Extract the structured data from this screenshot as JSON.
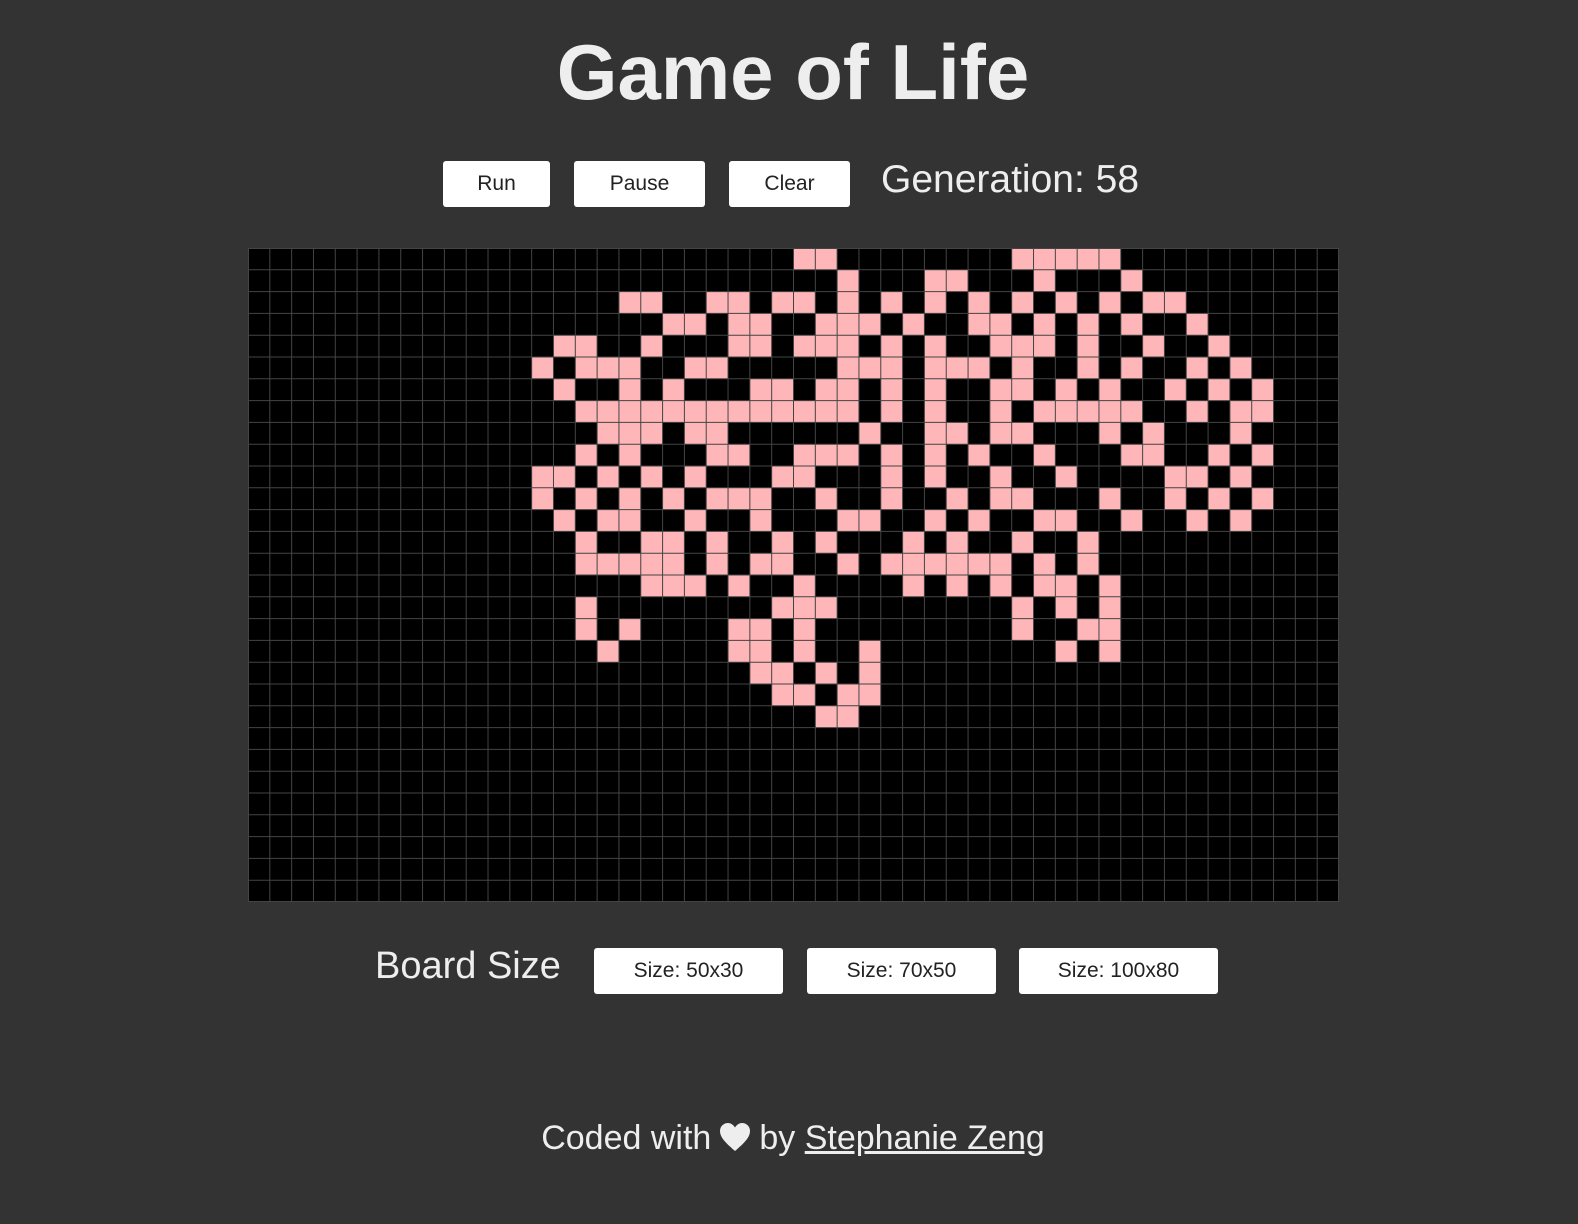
{
  "page": {
    "title": "Game of Life"
  },
  "controls": {
    "run_label": "Run",
    "pause_label": "Pause",
    "clear_label": "Clear",
    "generation_label": "Generation: ",
    "generation_value": "58"
  },
  "board": {
    "columns": 50,
    "rows": 30,
    "alive_color": "#ffb6b9",
    "dead_color": "#000000",
    "grid_color": "#444444",
    "live_cells": [
      [
        0,
        25
      ],
      [
        0,
        26
      ],
      [
        0,
        35
      ],
      [
        0,
        36
      ],
      [
        0,
        37
      ],
      [
        0,
        38
      ],
      [
        0,
        39
      ],
      [
        1,
        27
      ],
      [
        1,
        31
      ],
      [
        1,
        32
      ],
      [
        1,
        36
      ],
      [
        1,
        40
      ],
      [
        2,
        17
      ],
      [
        2,
        18
      ],
      [
        2,
        21
      ],
      [
        2,
        22
      ],
      [
        2,
        24
      ],
      [
        2,
        25
      ],
      [
        2,
        27
      ],
      [
        2,
        29
      ],
      [
        2,
        31
      ],
      [
        2,
        33
      ],
      [
        2,
        35
      ],
      [
        2,
        37
      ],
      [
        2,
        39
      ],
      [
        2,
        41
      ],
      [
        2,
        42
      ],
      [
        3,
        19
      ],
      [
        3,
        20
      ],
      [
        3,
        22
      ],
      [
        3,
        23
      ],
      [
        3,
        26
      ],
      [
        3,
        27
      ],
      [
        3,
        28
      ],
      [
        3,
        30
      ],
      [
        3,
        33
      ],
      [
        3,
        34
      ],
      [
        3,
        36
      ],
      [
        3,
        38
      ],
      [
        3,
        40
      ],
      [
        3,
        43
      ],
      [
        4,
        14
      ],
      [
        4,
        15
      ],
      [
        4,
        18
      ],
      [
        4,
        22
      ],
      [
        4,
        23
      ],
      [
        4,
        25
      ],
      [
        4,
        26
      ],
      [
        4,
        27
      ],
      [
        4,
        29
      ],
      [
        4,
        31
      ],
      [
        4,
        34
      ],
      [
        4,
        35
      ],
      [
        4,
        36
      ],
      [
        4,
        38
      ],
      [
        4,
        41
      ],
      [
        4,
        44
      ],
      [
        5,
        13
      ],
      [
        5,
        15
      ],
      [
        5,
        16
      ],
      [
        5,
        17
      ],
      [
        5,
        20
      ],
      [
        5,
        21
      ],
      [
        5,
        27
      ],
      [
        5,
        28
      ],
      [
        5,
        29
      ],
      [
        5,
        31
      ],
      [
        5,
        32
      ],
      [
        5,
        33
      ],
      [
        5,
        35
      ],
      [
        5,
        38
      ],
      [
        5,
        40
      ],
      [
        5,
        43
      ],
      [
        5,
        45
      ],
      [
        6,
        14
      ],
      [
        6,
        17
      ],
      [
        6,
        19
      ],
      [
        6,
        23
      ],
      [
        6,
        24
      ],
      [
        6,
        26
      ],
      [
        6,
        27
      ],
      [
        6,
        29
      ],
      [
        6,
        31
      ],
      [
        6,
        34
      ],
      [
        6,
        35
      ],
      [
        6,
        37
      ],
      [
        6,
        39
      ],
      [
        6,
        42
      ],
      [
        6,
        44
      ],
      [
        6,
        46
      ],
      [
        7,
        15
      ],
      [
        7,
        16
      ],
      [
        7,
        17
      ],
      [
        7,
        18
      ],
      [
        7,
        19
      ],
      [
        7,
        20
      ],
      [
        7,
        21
      ],
      [
        7,
        22
      ],
      [
        7,
        23
      ],
      [
        7,
        24
      ],
      [
        7,
        25
      ],
      [
        7,
        26
      ],
      [
        7,
        27
      ],
      [
        7,
        29
      ],
      [
        7,
        31
      ],
      [
        7,
        34
      ],
      [
        7,
        36
      ],
      [
        7,
        37
      ],
      [
        7,
        38
      ],
      [
        7,
        39
      ],
      [
        7,
        40
      ],
      [
        7,
        43
      ],
      [
        7,
        45
      ],
      [
        7,
        46
      ],
      [
        8,
        16
      ],
      [
        8,
        17
      ],
      [
        8,
        18
      ],
      [
        8,
        20
      ],
      [
        8,
        21
      ],
      [
        8,
        28
      ],
      [
        8,
        31
      ],
      [
        8,
        32
      ],
      [
        8,
        34
      ],
      [
        8,
        35
      ],
      [
        8,
        39
      ],
      [
        8,
        41
      ],
      [
        8,
        45
      ],
      [
        9,
        15
      ],
      [
        9,
        17
      ],
      [
        9,
        21
      ],
      [
        9,
        22
      ],
      [
        9,
        25
      ],
      [
        9,
        26
      ],
      [
        9,
        27
      ],
      [
        9,
        29
      ],
      [
        9,
        31
      ],
      [
        9,
        33
      ],
      [
        9,
        36
      ],
      [
        9,
        40
      ],
      [
        9,
        41
      ],
      [
        9,
        44
      ],
      [
        9,
        46
      ],
      [
        10,
        13
      ],
      [
        10,
        14
      ],
      [
        10,
        16
      ],
      [
        10,
        18
      ],
      [
        10,
        20
      ],
      [
        10,
        24
      ],
      [
        10,
        25
      ],
      [
        10,
        29
      ],
      [
        10,
        31
      ],
      [
        10,
        34
      ],
      [
        10,
        37
      ],
      [
        10,
        42
      ],
      [
        10,
        43
      ],
      [
        10,
        45
      ],
      [
        11,
        13
      ],
      [
        11,
        15
      ],
      [
        11,
        17
      ],
      [
        11,
        19
      ],
      [
        11,
        21
      ],
      [
        11,
        22
      ],
      [
        11,
        23
      ],
      [
        11,
        26
      ],
      [
        11,
        29
      ],
      [
        11,
        32
      ],
      [
        11,
        34
      ],
      [
        11,
        35
      ],
      [
        11,
        39
      ],
      [
        11,
        42
      ],
      [
        11,
        44
      ],
      [
        11,
        46
      ],
      [
        12,
        14
      ],
      [
        12,
        16
      ],
      [
        12,
        17
      ],
      [
        12,
        20
      ],
      [
        12,
        23
      ],
      [
        12,
        27
      ],
      [
        12,
        28
      ],
      [
        12,
        31
      ],
      [
        12,
        33
      ],
      [
        12,
        36
      ],
      [
        12,
        37
      ],
      [
        12,
        40
      ],
      [
        12,
        43
      ],
      [
        12,
        45
      ],
      [
        13,
        15
      ],
      [
        13,
        18
      ],
      [
        13,
        19
      ],
      [
        13,
        21
      ],
      [
        13,
        24
      ],
      [
        13,
        26
      ],
      [
        13,
        30
      ],
      [
        13,
        32
      ],
      [
        13,
        35
      ],
      [
        13,
        38
      ],
      [
        14,
        15
      ],
      [
        14,
        16
      ],
      [
        14,
        17
      ],
      [
        14,
        18
      ],
      [
        14,
        19
      ],
      [
        14,
        21
      ],
      [
        14,
        23
      ],
      [
        14,
        24
      ],
      [
        14,
        27
      ],
      [
        14,
        29
      ],
      [
        14,
        30
      ],
      [
        14,
        31
      ],
      [
        14,
        32
      ],
      [
        14,
        33
      ],
      [
        14,
        34
      ],
      [
        14,
        36
      ],
      [
        14,
        38
      ],
      [
        15,
        18
      ],
      [
        15,
        19
      ],
      [
        15,
        20
      ],
      [
        15,
        22
      ],
      [
        15,
        25
      ],
      [
        15,
        30
      ],
      [
        15,
        32
      ],
      [
        15,
        34
      ],
      [
        15,
        36
      ],
      [
        15,
        37
      ],
      [
        15,
        39
      ],
      [
        16,
        15
      ],
      [
        16,
        24
      ],
      [
        16,
        25
      ],
      [
        16,
        26
      ],
      [
        16,
        35
      ],
      [
        16,
        37
      ],
      [
        16,
        39
      ],
      [
        17,
        15
      ],
      [
        17,
        17
      ],
      [
        17,
        22
      ],
      [
        17,
        23
      ],
      [
        17,
        25
      ],
      [
        17,
        35
      ],
      [
        17,
        38
      ],
      [
        17,
        39
      ],
      [
        18,
        16
      ],
      [
        18,
        22
      ],
      [
        18,
        23
      ],
      [
        18,
        25
      ],
      [
        18,
        28
      ],
      [
        18,
        37
      ],
      [
        18,
        39
      ],
      [
        19,
        23
      ],
      [
        19,
        24
      ],
      [
        19,
        26
      ],
      [
        19,
        28
      ],
      [
        20,
        24
      ],
      [
        20,
        25
      ],
      [
        20,
        27
      ],
      [
        20,
        28
      ],
      [
        21,
        26
      ],
      [
        21,
        27
      ]
    ]
  },
  "board_size": {
    "label": "Board Size",
    "options": [
      "Size: 50x30",
      "Size: 70x50",
      "Size: 100x80"
    ]
  },
  "footer": {
    "prefix": "Coded with",
    "heart_icon": "heart-icon",
    "by": "by",
    "author": "Stephanie Zeng"
  }
}
